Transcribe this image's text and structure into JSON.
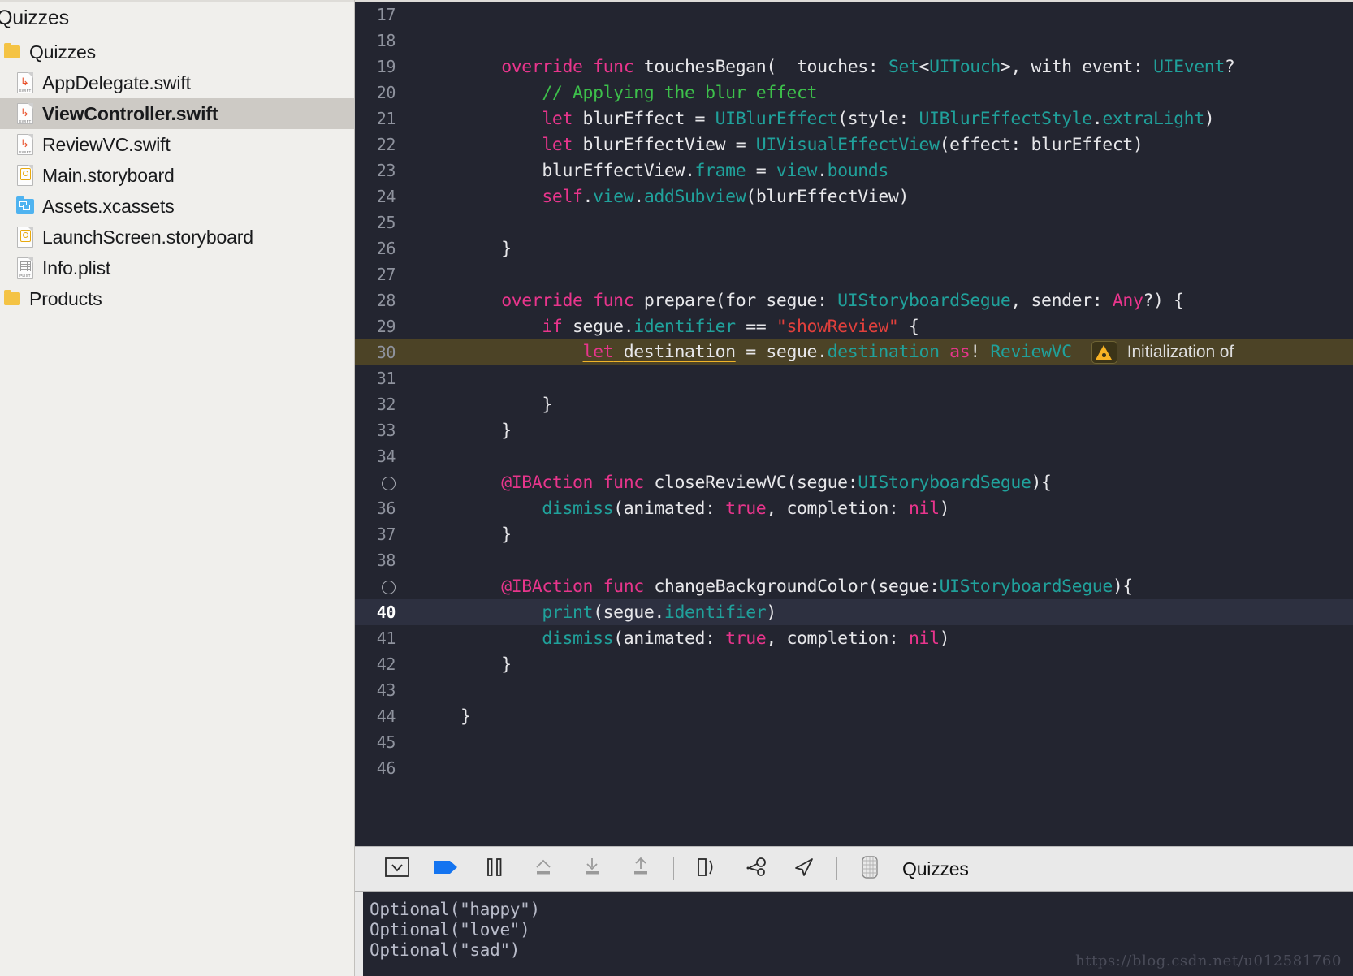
{
  "navigator": {
    "root_title": "Quizzes",
    "items": [
      {
        "label": "Quizzes",
        "icon": "folder-icon",
        "indent": 0,
        "selected": false
      },
      {
        "label": "AppDelegate.swift",
        "icon": "swift-file-icon",
        "indent": 1,
        "selected": false
      },
      {
        "label": "ViewController.swift",
        "icon": "swift-file-icon",
        "indent": 1,
        "selected": true
      },
      {
        "label": "ReviewVC.swift",
        "icon": "swift-file-icon",
        "indent": 1,
        "selected": false
      },
      {
        "label": "Main.storyboard",
        "icon": "storyboard-file-icon",
        "indent": 1,
        "selected": false
      },
      {
        "label": "Assets.xcassets",
        "icon": "xcassets-folder-icon",
        "indent": 1,
        "selected": false
      },
      {
        "label": "LaunchScreen.storyboard",
        "icon": "storyboard-file-icon",
        "indent": 1,
        "selected": false
      },
      {
        "label": "Info.plist",
        "icon": "plist-file-icon",
        "indent": 1,
        "selected": false
      },
      {
        "label": "Products",
        "icon": "folder-icon",
        "indent": 0,
        "selected": false
      }
    ]
  },
  "editor": {
    "language": "swift",
    "warning_message": "Initialization of",
    "lines": [
      {
        "num": "17",
        "state": "normal",
        "tokens": []
      },
      {
        "num": "18",
        "state": "normal",
        "tokens": []
      },
      {
        "num": "19",
        "state": "normal",
        "tokens": [
          {
            "t": "    ",
            "c": "p"
          },
          {
            "t": "override",
            "c": "k"
          },
          {
            "t": " ",
            "c": "p"
          },
          {
            "t": "func",
            "c": "k"
          },
          {
            "t": " touchesBegan(",
            "c": "p"
          },
          {
            "t": "_",
            "c": "k"
          },
          {
            "t": " touches: ",
            "c": "p"
          },
          {
            "t": "Set",
            "c": "t"
          },
          {
            "t": "<",
            "c": "p"
          },
          {
            "t": "UITouch",
            "c": "t"
          },
          {
            "t": ">, with event: ",
            "c": "p"
          },
          {
            "t": "UIEvent",
            "c": "t"
          },
          {
            "t": "?",
            "c": "p"
          }
        ]
      },
      {
        "num": "20",
        "state": "normal",
        "tokens": [
          {
            "t": "        ",
            "c": "p"
          },
          {
            "t": "// Applying the blur effect",
            "c": "c"
          }
        ]
      },
      {
        "num": "21",
        "state": "normal",
        "tokens": [
          {
            "t": "        ",
            "c": "p"
          },
          {
            "t": "let",
            "c": "k"
          },
          {
            "t": " blurEffect = ",
            "c": "p"
          },
          {
            "t": "UIBlurEffect",
            "c": "t"
          },
          {
            "t": "(style: ",
            "c": "p"
          },
          {
            "t": "UIBlurEffectStyle",
            "c": "t"
          },
          {
            "t": ".",
            "c": "p"
          },
          {
            "t": "extraLight",
            "c": "t"
          },
          {
            "t": ")",
            "c": "p"
          }
        ]
      },
      {
        "num": "22",
        "state": "normal",
        "tokens": [
          {
            "t": "        ",
            "c": "p"
          },
          {
            "t": "let",
            "c": "k"
          },
          {
            "t": " blurEffectView = ",
            "c": "p"
          },
          {
            "t": "UIVisualEffectView",
            "c": "t"
          },
          {
            "t": "(effect: blurEffect)",
            "c": "p"
          }
        ]
      },
      {
        "num": "23",
        "state": "normal",
        "tokens": [
          {
            "t": "        blurEffectView.",
            "c": "p"
          },
          {
            "t": "frame",
            "c": "t"
          },
          {
            "t": " = ",
            "c": "p"
          },
          {
            "t": "view",
            "c": "t"
          },
          {
            "t": ".",
            "c": "p"
          },
          {
            "t": "bounds",
            "c": "t"
          }
        ]
      },
      {
        "num": "24",
        "state": "normal",
        "tokens": [
          {
            "t": "        ",
            "c": "p"
          },
          {
            "t": "self",
            "c": "k"
          },
          {
            "t": ".",
            "c": "p"
          },
          {
            "t": "view",
            "c": "t"
          },
          {
            "t": ".",
            "c": "p"
          },
          {
            "t": "addSubview",
            "c": "t"
          },
          {
            "t": "(blurEffectView)",
            "c": "p"
          }
        ]
      },
      {
        "num": "25",
        "state": "normal",
        "tokens": []
      },
      {
        "num": "26",
        "state": "normal",
        "tokens": [
          {
            "t": "    }",
            "c": "p"
          }
        ]
      },
      {
        "num": "27",
        "state": "normal",
        "tokens": []
      },
      {
        "num": "28",
        "state": "normal",
        "tokens": [
          {
            "t": "    ",
            "c": "p"
          },
          {
            "t": "override",
            "c": "k"
          },
          {
            "t": " ",
            "c": "p"
          },
          {
            "t": "func",
            "c": "k"
          },
          {
            "t": " prepare(for segue: ",
            "c": "p"
          },
          {
            "t": "UIStoryboardSegue",
            "c": "t"
          },
          {
            "t": ", sender: ",
            "c": "p"
          },
          {
            "t": "Any",
            "c": "k"
          },
          {
            "t": "?) {",
            "c": "p"
          }
        ]
      },
      {
        "num": "29",
        "state": "normal",
        "tokens": [
          {
            "t": "        ",
            "c": "p"
          },
          {
            "t": "if",
            "c": "k"
          },
          {
            "t": " segue.",
            "c": "p"
          },
          {
            "t": "identifier",
            "c": "t"
          },
          {
            "t": " == ",
            "c": "p"
          },
          {
            "t": "\"showReview\"",
            "c": "s"
          },
          {
            "t": " {",
            "c": "p"
          }
        ]
      },
      {
        "num": "30",
        "state": "warning",
        "tokens": [
          {
            "t": "            ",
            "c": "p"
          },
          {
            "t": "let",
            "c": "k u"
          },
          {
            "t": " ",
            "c": "p u"
          },
          {
            "t": "destination",
            "c": "p u"
          },
          {
            "t": " = segue.",
            "c": "p"
          },
          {
            "t": "destination",
            "c": "t"
          },
          {
            "t": " ",
            "c": "p"
          },
          {
            "t": "as",
            "c": "k"
          },
          {
            "t": "! ",
            "c": "p"
          },
          {
            "t": "ReviewVC",
            "c": "t"
          }
        ]
      },
      {
        "num": "31",
        "state": "normal",
        "tokens": []
      },
      {
        "num": "32",
        "state": "normal",
        "tokens": [
          {
            "t": "        }",
            "c": "p"
          }
        ]
      },
      {
        "num": "33",
        "state": "normal",
        "tokens": [
          {
            "t": "    }",
            "c": "p"
          }
        ]
      },
      {
        "num": "34",
        "state": "normal",
        "tokens": []
      },
      {
        "num": "",
        "state": "marker",
        "tokens": [
          {
            "t": "    ",
            "c": "p"
          },
          {
            "t": "@IBAction",
            "c": "att"
          },
          {
            "t": " ",
            "c": "p"
          },
          {
            "t": "func",
            "c": "k"
          },
          {
            "t": " closeReviewVC(segue:",
            "c": "p"
          },
          {
            "t": "UIStoryboardSegue",
            "c": "t"
          },
          {
            "t": "){",
            "c": "p"
          }
        ]
      },
      {
        "num": "36",
        "state": "normal",
        "tokens": [
          {
            "t": "        ",
            "c": "p"
          },
          {
            "t": "dismiss",
            "c": "t"
          },
          {
            "t": "(animated: ",
            "c": "p"
          },
          {
            "t": "true",
            "c": "k"
          },
          {
            "t": ", completion: ",
            "c": "p"
          },
          {
            "t": "nil",
            "c": "k"
          },
          {
            "t": ")",
            "c": "p"
          }
        ]
      },
      {
        "num": "37",
        "state": "normal",
        "tokens": [
          {
            "t": "    }",
            "c": "p"
          }
        ]
      },
      {
        "num": "38",
        "state": "normal",
        "tokens": []
      },
      {
        "num": "",
        "state": "marker",
        "tokens": [
          {
            "t": "    ",
            "c": "p"
          },
          {
            "t": "@IBAction",
            "c": "att"
          },
          {
            "t": " ",
            "c": "p"
          },
          {
            "t": "func",
            "c": "k"
          },
          {
            "t": " changeBackgroundColor(segue:",
            "c": "p"
          },
          {
            "t": "UIStoryboardSegue",
            "c": "t"
          },
          {
            "t": "){",
            "c": "p"
          }
        ]
      },
      {
        "num": "40",
        "state": "current",
        "tokens": [
          {
            "t": "        ",
            "c": "p"
          },
          {
            "t": "print",
            "c": "t"
          },
          {
            "t": "(segue.",
            "c": "p"
          },
          {
            "t": "identifier",
            "c": "t"
          },
          {
            "t": ")",
            "c": "p"
          }
        ]
      },
      {
        "num": "41",
        "state": "normal",
        "tokens": [
          {
            "t": "        ",
            "c": "p"
          },
          {
            "t": "dismiss",
            "c": "t"
          },
          {
            "t": "(animated: ",
            "c": "p"
          },
          {
            "t": "true",
            "c": "k"
          },
          {
            "t": ", completion: ",
            "c": "p"
          },
          {
            "t": "nil",
            "c": "k"
          },
          {
            "t": ")",
            "c": "p"
          }
        ]
      },
      {
        "num": "42",
        "state": "normal",
        "tokens": [
          {
            "t": "    }",
            "c": "p"
          }
        ]
      },
      {
        "num": "43",
        "state": "normal",
        "tokens": []
      },
      {
        "num": "44",
        "state": "normal",
        "tokens": [
          {
            "t": "}",
            "c": "p"
          }
        ]
      },
      {
        "num": "45",
        "state": "normal",
        "tokens": []
      },
      {
        "num": "46",
        "state": "normal",
        "tokens": []
      }
    ]
  },
  "debug_bar": {
    "scheme_label": "Quizzes",
    "buttons": [
      {
        "name": "hide-debug-area-button",
        "icon": "chevron-down-box-icon"
      },
      {
        "name": "continue-button",
        "icon": "continue-arrow-icon"
      },
      {
        "name": "pause-button",
        "icon": "pause-bars-icon"
      },
      {
        "name": "step-over-button",
        "icon": "step-over-icon"
      },
      {
        "name": "step-into-button",
        "icon": "step-into-icon"
      },
      {
        "name": "step-out-button",
        "icon": "step-out-icon"
      },
      {
        "name": "view-hierarchy-button",
        "icon": "view-hierarchy-icon"
      },
      {
        "name": "memory-graph-button",
        "icon": "memory-graph-icon"
      },
      {
        "name": "simulate-location-button",
        "icon": "location-arrow-icon"
      },
      {
        "name": "process-grid-button",
        "icon": "process-grid-icon"
      }
    ]
  },
  "console": {
    "lines": [
      "Optional(\"happy\")",
      "Optional(\"love\")",
      "Optional(\"sad\")"
    ]
  },
  "watermark": "https://blog.csdn.net/u012581760",
  "colors": {
    "editor_bg": "#232530",
    "sidebar_bg": "#f0efec",
    "sidebar_selected": "#cdcac5",
    "warning_row_bg": "#4c4326",
    "current_row_bg": "#2d3040",
    "keyword": "#e8358c",
    "type": "#20a19b",
    "string": "#e0403c",
    "comment": "#3dc04b",
    "warning_icon": "#f8b324",
    "continue_icon": "#1474f0"
  }
}
